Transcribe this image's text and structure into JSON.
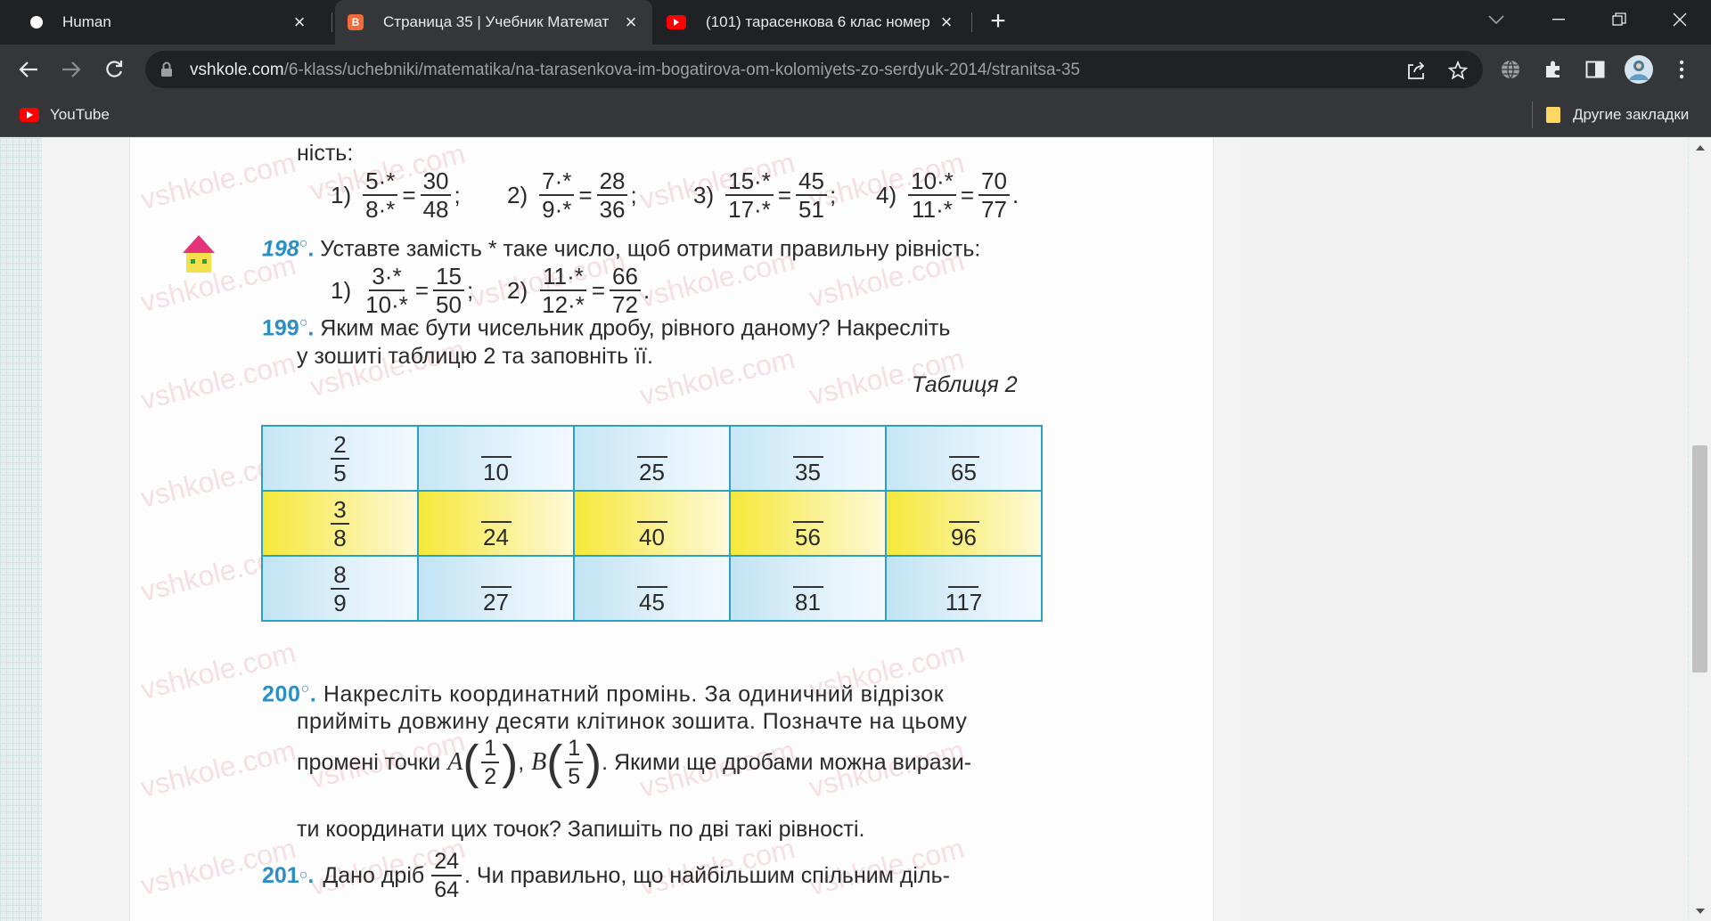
{
  "browser": {
    "tabs": [
      {
        "title": "Human",
        "active": false
      },
      {
        "title": "Страница 35 | Учебник Математ",
        "active": true
      },
      {
        "title": "(101) тарасенкова 6 клас номер",
        "active": false
      }
    ],
    "url_host": "vshkole.com",
    "url_path": "/6-klass/uchebniki/matematika/na-tarasenkova-im-bogatirova-om-kolomiyets-zo-serdyuk-2014/stranitsa-35",
    "bookmarks": [
      {
        "label": "YouTube"
      }
    ],
    "other_bookmarks": "Другие закладки",
    "tab2_favicon_letter": "B"
  },
  "book": {
    "top_fragment": "ність:",
    "ex197": {
      "items": [
        {
          "label": "1)",
          "a_num": "5·*",
          "a_den": "8·*",
          "b_num": "30",
          "b_den": "48",
          "end": ";"
        },
        {
          "label": "2)",
          "a_num": "7·*",
          "a_den": "9·*",
          "b_num": "28",
          "b_den": "36",
          "end": ";"
        },
        {
          "label": "3)",
          "a_num": "15·*",
          "a_den": "17·*",
          "b_num": "45",
          "b_den": "51",
          "end": ";"
        },
        {
          "label": "4)",
          "a_num": "10·*",
          "a_den": "11·*",
          "b_num": "70",
          "b_den": "77",
          "end": "."
        }
      ]
    },
    "ex198": {
      "number": "198",
      "text": "Уставте замість * таке число, щоб отримати правильну рівність:",
      "items": [
        {
          "label": "1)",
          "a_num": "3·*",
          "a_den": "10·*",
          "b_num": "15",
          "b_den": "50",
          "end": ";"
        },
        {
          "label": "2)",
          "a_num": "11·*",
          "a_den": "12·*",
          "b_num": "66",
          "b_den": "72",
          "end": "."
        }
      ]
    },
    "ex199": {
      "number": "199",
      "line1": "Яким має бути чисельник дробу, рівного даному? Накресліть",
      "line2": "у зошиті таблицю 2 та заповніть її.",
      "table_caption": "Таблиця 2",
      "table": [
        {
          "given_num": "2",
          "given_den": "5",
          "dens": [
            "10",
            "25",
            "35",
            "65"
          ]
        },
        {
          "given_num": "3",
          "given_den": "8",
          "dens": [
            "24",
            "40",
            "56",
            "96"
          ]
        },
        {
          "given_num": "8",
          "given_den": "9",
          "dens": [
            "27",
            "45",
            "81",
            "117"
          ]
        }
      ]
    },
    "ex200": {
      "number": "200",
      "line1": "Накресліть координатний промінь. За одиничний відрізок",
      "line2": "прийміть довжину десяти клітинок зошита. Позначте на цьому",
      "line3_before": "промені точки",
      "pointA": "A",
      "pointA_num": "1",
      "pointA_den": "2",
      "pointB": "B",
      "pointB_num": "1",
      "pointB_den": "5",
      "line3_after": ". Якими ще дробами можна вирази-",
      "line4": "ти координати цих точок? Запишіть по дві такі рівності."
    },
    "ex201": {
      "number": "201",
      "before": "Дано дріб",
      "frac_num": "24",
      "frac_den": "64",
      "after": ". Чи правильно, що найбільшим спільним діль-"
    },
    "watermark": "vshkole.com"
  }
}
